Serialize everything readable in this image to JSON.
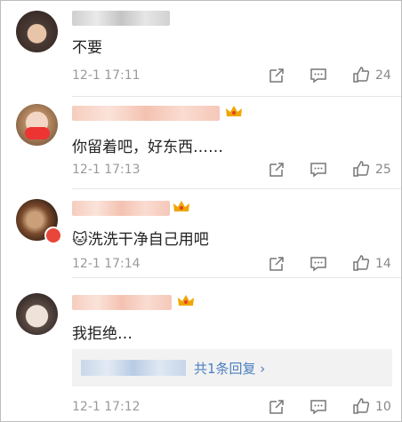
{
  "comments": [
    {
      "text": "不要",
      "time": "12-1 17:11",
      "likes": "24"
    },
    {
      "text": "你留着吧，好东西……",
      "time": "12-1 17:13",
      "likes": "25"
    },
    {
      "emoji": "🐱",
      "text": "洗洗干净自己用吧",
      "time": "12-1 17:14",
      "likes": "14"
    },
    {
      "text": "我拒绝…",
      "time": "12-1 17:12",
      "likes": "10",
      "reply_link": "共1条回复 ›"
    }
  ],
  "icons": {
    "share": "share-icon",
    "comment": "comment-icon",
    "like": "thumbs-up-icon",
    "vip": "crown-icon"
  },
  "colors": {
    "link": "#4a7fc1",
    "name_blur": "#f6c8b8",
    "crown": "#f0a500"
  }
}
